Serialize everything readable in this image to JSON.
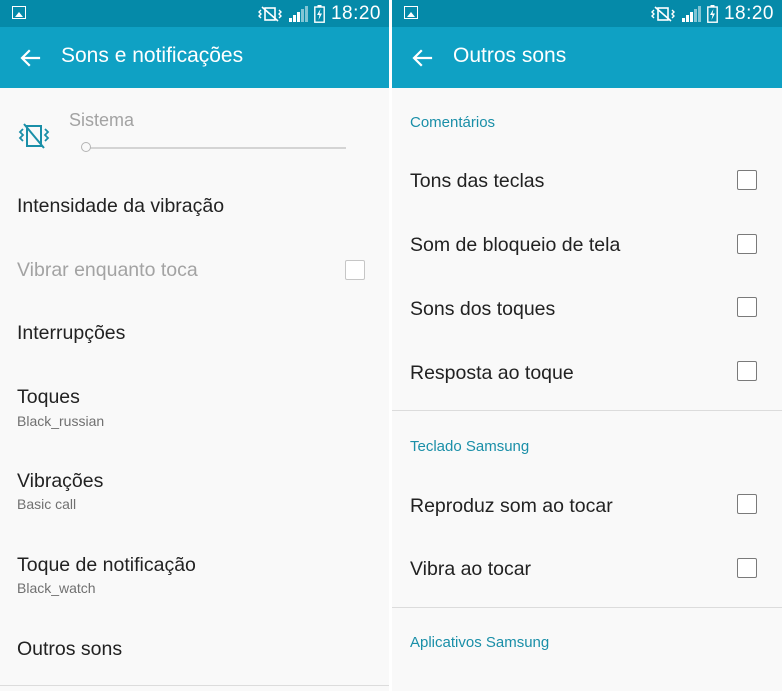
{
  "status_bar": {
    "time": "18:20"
  },
  "left": {
    "title": "Sons e notificações",
    "volume": {
      "label": "Sistema",
      "level": 0
    },
    "items": [
      {
        "title": "Intensidade da vibração",
        "subtitle": ""
      },
      {
        "title": "Vibrar enquanto toca",
        "subtitle": "",
        "checkbox": true,
        "checked": false,
        "disabled": true
      },
      {
        "title": "Interrupções",
        "subtitle": ""
      },
      {
        "title": "Toques",
        "subtitle": "Black_russian"
      },
      {
        "title": "Vibrações",
        "subtitle": "Basic call"
      },
      {
        "title": "Toque de notificação",
        "subtitle": "Black_watch"
      },
      {
        "title": "Outros sons",
        "subtitle": ""
      }
    ]
  },
  "right": {
    "title": "Outros sons",
    "sections": [
      {
        "header": "Comentários",
        "items": [
          {
            "title": "Tons das teclas",
            "checked": false
          },
          {
            "title": "Som de bloqueio de tela",
            "checked": false
          },
          {
            "title": "Sons dos toques",
            "checked": false
          },
          {
            "title": "Resposta ao toque",
            "checked": false
          }
        ]
      },
      {
        "header": "Teclado Samsung",
        "items": [
          {
            "title": "Reproduz som ao tocar",
            "checked": false
          },
          {
            "title": "Vibra ao tocar",
            "checked": false
          }
        ]
      },
      {
        "header": "Aplicativos Samsung",
        "items": []
      }
    ]
  },
  "colors": {
    "status_bar": "#058aa9",
    "app_bar": "#0fa1c4",
    "section_header": "#1a8fa8",
    "background": "#f9f9f9"
  },
  "icons": [
    "image-notification-icon",
    "mute-vibrate-icon",
    "signal-icon",
    "battery-charging-icon",
    "back-arrow-icon",
    "vibrate-mode-icon"
  ]
}
